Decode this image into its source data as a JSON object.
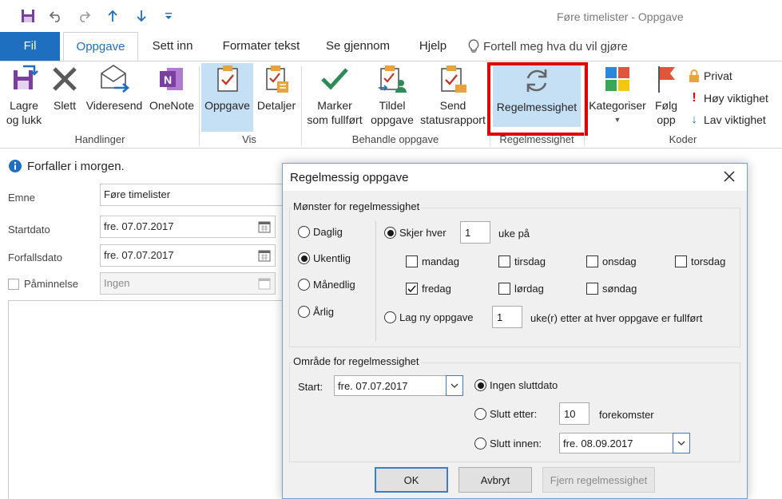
{
  "window": {
    "title": "Føre timelister  -  Oppgave"
  },
  "tabs": [
    "Fil",
    "Oppgave",
    "Sett inn",
    "Formater tekst",
    "Se gjennom",
    "Hjelp"
  ],
  "tell_me": "Fortell meg hva du vil gjøre",
  "ribbon": {
    "save_close": [
      "Lagre",
      "og lukk"
    ],
    "delete": "Slett",
    "forward": "Videresend",
    "onenote": "OneNote",
    "group_actions": "Handlinger",
    "task": "Oppgave",
    "details": "Detaljer",
    "group_show": "Vis",
    "mark_complete": [
      "Marker",
      "som fullført"
    ],
    "assign_task": [
      "Tildel",
      "oppgave"
    ],
    "send_status": [
      "Send",
      "statusrapport"
    ],
    "group_manage": "Behandle oppgave",
    "recurrence": "Regelmessighet",
    "group_recurrence": "Regelmessighet",
    "categorize": "Kategoriser",
    "follow_up": [
      "Følg",
      "opp"
    ],
    "private": "Privat",
    "high_importance": "Høy viktighet",
    "low_importance": "Lav viktighet",
    "group_tags": "Koder",
    "accent": "#1e6fbf",
    "highlight": "#e00000"
  },
  "form": {
    "info": "Forfaller i morgen.",
    "subject_label": "Emne",
    "subject_value": "Føre timelister",
    "start_label": "Startdato",
    "start_value": "fre. 07.07.2017",
    "due_label": "Forfallsdato",
    "due_value": "fre. 07.07.2017",
    "reminder_label": "Påminnelse",
    "reminder_value": "Ingen"
  },
  "dialog": {
    "title": "Regelmessig oppgave",
    "pattern_title": "Mønster for regelmessighet",
    "daily": "Daglig",
    "weekly": "Ukentlig",
    "monthly": "Månedlig",
    "yearly": "Årlig",
    "every": "Skjer hver",
    "every_value": "1",
    "weeks_on": "uke på",
    "days": {
      "mon": "mandag",
      "tue": "tirsdag",
      "wed": "onsdag",
      "thu": "torsdag",
      "fri": "fredag",
      "sat": "lørdag",
      "sun": "søndag"
    },
    "regenerate": "Lag ny oppgave",
    "regenerate_value": "1",
    "regenerate_suffix": "uke(r) etter at hver oppgave er fullført",
    "range_title": "Område for regelmessighet",
    "start_label": "Start:",
    "start_value": "fre. 07.07.2017",
    "no_end": "Ingen sluttdato",
    "end_after": "Slutt etter:",
    "end_after_value": "10",
    "occurrences": "forekomster",
    "end_by": "Slutt innen:",
    "end_by_value": "fre. 08.09.2017",
    "ok": "OK",
    "cancel": "Avbryt",
    "remove": "Fjern regelmessighet"
  }
}
